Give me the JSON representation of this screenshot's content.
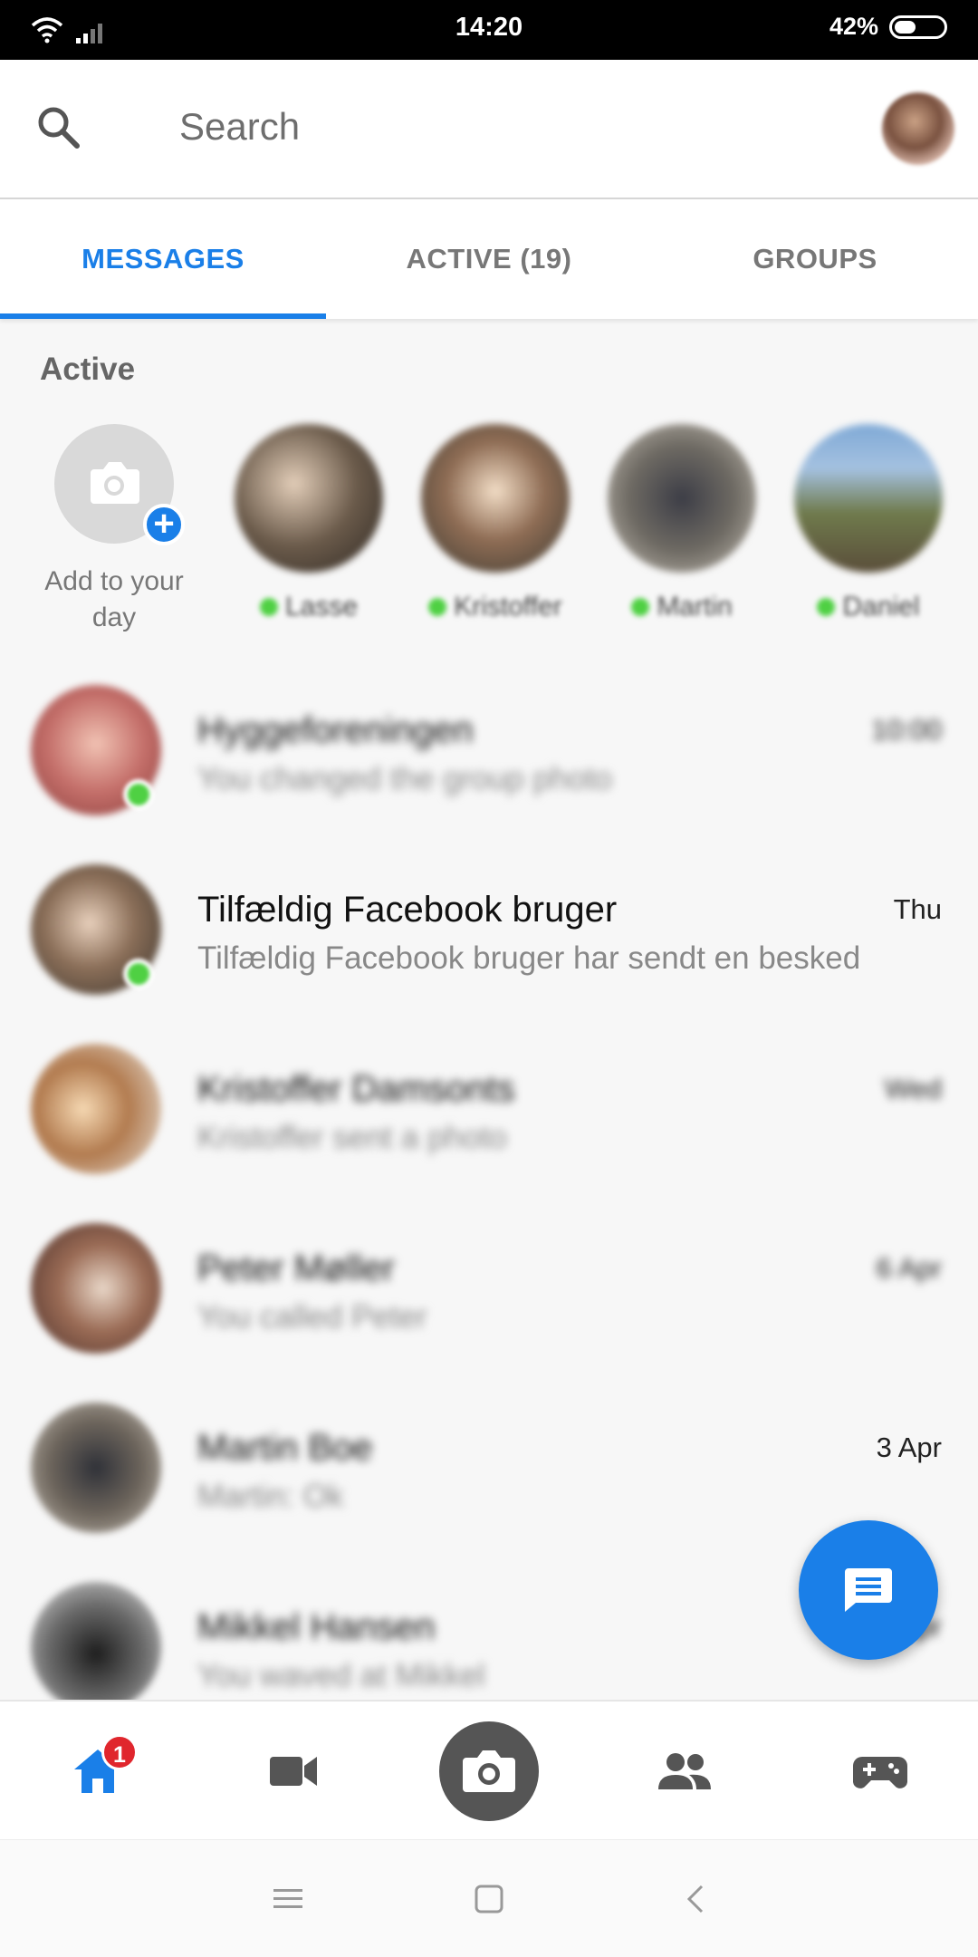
{
  "status_bar": {
    "time": "14:20",
    "battery": "42%",
    "battery_level": 0.42
  },
  "header": {
    "search_placeholder": "Search"
  },
  "tabs": [
    {
      "label": "MESSAGES",
      "active": true
    },
    {
      "label": "ACTIVE (19)",
      "active": false
    },
    {
      "label": "GROUPS",
      "active": false
    }
  ],
  "active_section": {
    "title": "Active",
    "add_story_label": "Add to your day",
    "users": [
      {
        "name": "Lasse"
      },
      {
        "name": "Kristoffer"
      },
      {
        "name": "Martin"
      },
      {
        "name": "Daniel"
      }
    ]
  },
  "conversations": [
    {
      "name": "Hyggeforeningen",
      "snippet": "You changed the group photo",
      "time": "10:00",
      "online": true,
      "blurred": true
    },
    {
      "name": "Tilfældig Facebook bruger",
      "snippet": "Tilfældig Facebook bruger har sendt en besked",
      "time": "Thu",
      "online": true,
      "blurred": false
    },
    {
      "name": "Kristoffer Damsonts",
      "snippet": "Kristoffer sent a photo",
      "time": "Wed",
      "online": false,
      "blurred": true
    },
    {
      "name": "Peter Møller",
      "snippet": "You called Peter",
      "time": "6 Apr",
      "online": false,
      "blurred": true
    },
    {
      "name": "Martin Boe",
      "snippet": "Martin: Ok",
      "time": "3 Apr",
      "online": false,
      "blurred": true
    },
    {
      "name": "Mikkel Hansen",
      "snippet": "You waved at Mikkel",
      "time": "1 Apr",
      "online": false,
      "blurred": true
    }
  ],
  "bottom_nav": {
    "home_badge": "1",
    "items": [
      "home-icon",
      "video-icon",
      "camera-icon",
      "people-icon",
      "games-icon"
    ]
  },
  "colors": {
    "accent": "#1a7fe8",
    "online": "#4fd043",
    "badge": "#e0262d"
  }
}
